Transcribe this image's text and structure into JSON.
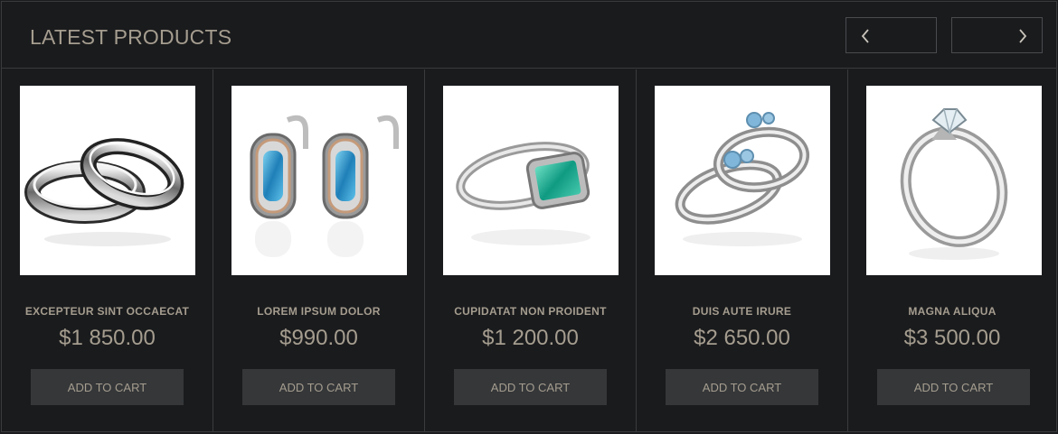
{
  "header": {
    "title": "LATEST PRODUCTS",
    "prev_icon": "chevron-left-icon",
    "next_icon": "chevron-right-icon"
  },
  "products": [
    {
      "name": "EXCEPTEUR SINT OCCAECAT",
      "price": "$1 850.00",
      "cart_label": "ADD TO CART",
      "image": "stacked-eternity-rings"
    },
    {
      "name": "LOREM IPSUM DOLOR",
      "price": "$990.00",
      "cart_label": "ADD TO CART",
      "image": "topaz-earrings"
    },
    {
      "name": "CUPIDATAT NON PROIDENT",
      "price": "$1 200.00",
      "cart_label": "ADD TO CART",
      "image": "emerald-ring"
    },
    {
      "name": "DUIS AUTE IRURE",
      "price": "$2 650.00",
      "cart_label": "ADD TO CART",
      "image": "aquamarine-twist-ring"
    },
    {
      "name": "MAGNA ALIQUA",
      "price": "$3 500.00",
      "cart_label": "ADD TO CART",
      "image": "solitaire-diamond-ring"
    }
  ],
  "colors": {
    "background": "#1a1b1d",
    "text": "#a59d8f",
    "button": "#353739",
    "border": "#3a3b3d"
  }
}
